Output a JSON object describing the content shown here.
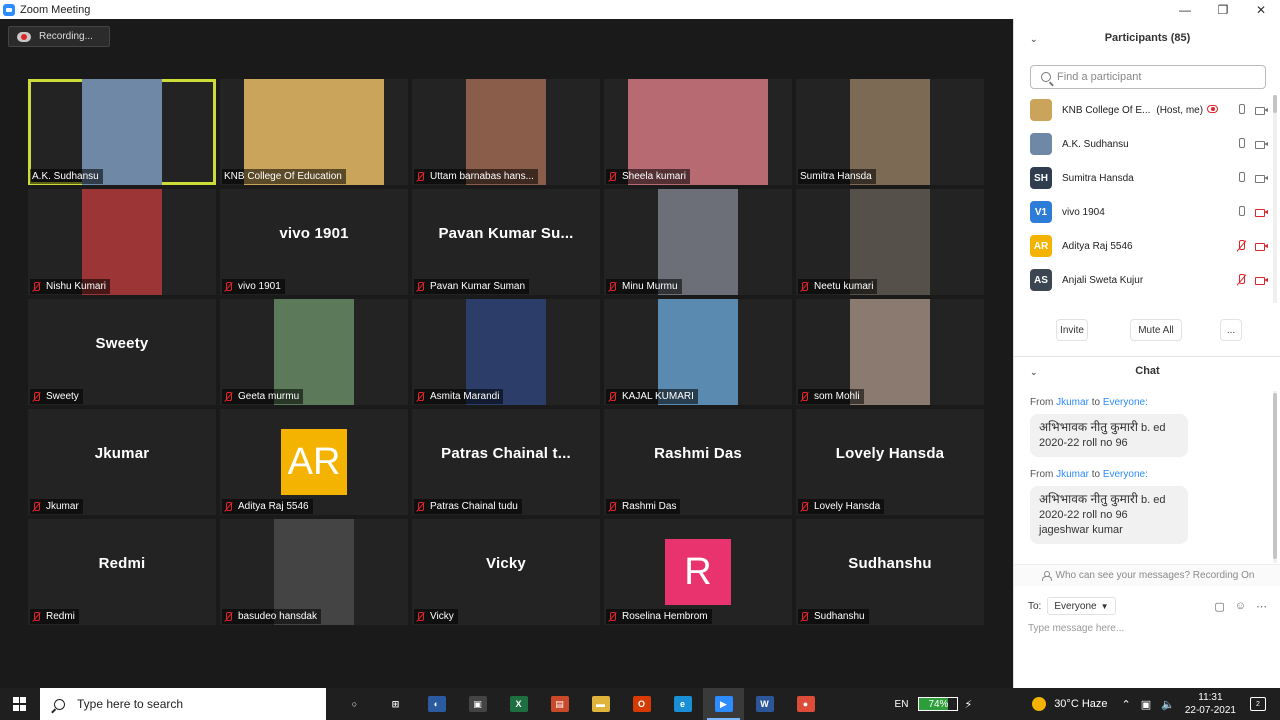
{
  "window": {
    "title": "Zoom Meeting",
    "controls": [
      "—",
      "❐",
      "✕"
    ]
  },
  "recording": {
    "label": "Recording..."
  },
  "tiles": [
    {
      "name": "A.K. Sudhansu",
      "type": "video",
      "muted": false,
      "active": true,
      "bg": "#6e88a6"
    },
    {
      "name": "KNB College Of Education",
      "type": "video",
      "muted": false,
      "bg": "#c9a45a"
    },
    {
      "name": "Uttam barnabas hans...",
      "type": "video",
      "muted": true,
      "bg": "#8a5c4a"
    },
    {
      "name": "Sheela kumari",
      "type": "video",
      "muted": true,
      "bg": "#b86a73"
    },
    {
      "name": "Sumitra Hansda",
      "type": "video",
      "muted": false,
      "bg": "#7d6a55"
    },
    {
      "name": "Nishu Kumari",
      "type": "video",
      "muted": true,
      "bg": "#9c3535"
    },
    {
      "name": "vivo 1901",
      "type": "name",
      "big": "vivo 1901",
      "muted": true
    },
    {
      "name": "Pavan Kumar Suman",
      "type": "name",
      "big": "Pavan Kumar Su...",
      "muted": true
    },
    {
      "name": "Minu Murmu",
      "type": "video",
      "muted": true,
      "bg": "#6c6f78"
    },
    {
      "name": "Neetu kumari",
      "type": "video",
      "muted": true,
      "bg": "#55504a"
    },
    {
      "name": "Sweety",
      "type": "name",
      "big": "Sweety",
      "muted": true
    },
    {
      "name": "Geeta murmu",
      "type": "video",
      "muted": true,
      "bg": "#5c7a5a"
    },
    {
      "name": "Asmita Marandi",
      "type": "video",
      "muted": true,
      "bg": "#2c3d6a"
    },
    {
      "name": "KAJAL KUMARI",
      "type": "video",
      "muted": true,
      "bg": "#5a8ab0"
    },
    {
      "name": "som Mohli",
      "type": "video",
      "muted": true,
      "bg": "#8a7a70"
    },
    {
      "name": "Jkumar",
      "type": "name",
      "big": "Jkumar",
      "muted": true
    },
    {
      "name": "Aditya Raj 5546",
      "type": "avatar",
      "big": "AR",
      "avatar_color": "#f5b301",
      "muted": true
    },
    {
      "name": "Patras Chainal tudu",
      "type": "name",
      "big": "Patras Chainal t...",
      "muted": true
    },
    {
      "name": "Rashmi Das",
      "type": "name",
      "big": "Rashmi Das",
      "muted": true
    },
    {
      "name": "Lovely Hansda",
      "type": "name",
      "big": "Lovely Hansda",
      "muted": true
    },
    {
      "name": "Redmi",
      "type": "name",
      "big": "Redmi",
      "muted": true
    },
    {
      "name": "basudeo hansdak",
      "type": "video",
      "muted": true,
      "bg": "#444444"
    },
    {
      "name": "Vicky",
      "type": "name",
      "big": "Vicky",
      "muted": true
    },
    {
      "name": "Roselina Hembrom",
      "type": "avatar",
      "big": "R",
      "avatar_color": "#e8336f",
      "muted": true
    },
    {
      "name": "Sudhanshu",
      "type": "name",
      "big": "Sudhanshu",
      "muted": true
    }
  ],
  "participants": {
    "title": "Participants (85)",
    "search_placeholder": "Find a participant",
    "list": [
      {
        "name": "KNB College Of E...",
        "role": "(Host, me)",
        "initials": "",
        "avatar_color": "#c9a45a",
        "mic": "on",
        "cam": "on",
        "recording": true
      },
      {
        "name": "A.K. Sudhansu",
        "role": "",
        "initials": "",
        "avatar_color": "#6e88a6",
        "mic": "on",
        "cam": "on"
      },
      {
        "name": "Sumitra Hansda",
        "role": "",
        "initials": "SH",
        "avatar_color": "#2f3d4f",
        "mic": "on",
        "cam": "on"
      },
      {
        "name": "vivo 1904",
        "role": "",
        "initials": "V1",
        "avatar_color": "#2d7cd8",
        "mic": "on",
        "cam": "off"
      },
      {
        "name": "Aditya Raj 5546",
        "role": "",
        "initials": "AR",
        "avatar_color": "#f5b301",
        "mic": "off",
        "cam": "off"
      },
      {
        "name": "Anjali Sweta Kujur",
        "role": "",
        "initials": "AS",
        "avatar_color": "#3c4653",
        "mic": "off",
        "cam": "off"
      }
    ],
    "buttons": {
      "invite": "Invite",
      "mute_all": "Mute All",
      "more": "..."
    }
  },
  "chat": {
    "title": "Chat",
    "messages": [
      {
        "from_prefix": "From",
        "from": "Jkumar",
        "to_word": "to",
        "to": "Everyone:",
        "hindi": "अभिभावक नीतु कुमारी",
        "text": " b. ed 2020-22 roll no 96"
      },
      {
        "from_prefix": "From",
        "from": "Jkumar",
        "to_word": "to",
        "to": "Everyone:",
        "hindi": "अभिभावक नीतु कुमारी",
        "text": " b. ed 2020-22 roll no 96  jageshwar kumar"
      }
    ],
    "note": "Who can see your messages? Recording On",
    "to_label": "To:",
    "to_value": "Everyone",
    "input_placeholder": "Type message here..."
  },
  "taskbar": {
    "search_placeholder": "Type here to search",
    "apps": [
      {
        "name": "cortana",
        "glyph": "○",
        "color": "transparent"
      },
      {
        "name": "task-view",
        "glyph": "⊞",
        "color": "transparent"
      },
      {
        "name": "app-1",
        "glyph": "◐",
        "color": "#2a5aa0"
      },
      {
        "name": "store",
        "glyph": "▣",
        "color": "#444"
      },
      {
        "name": "excel",
        "glyph": "X",
        "color": "#1d6f42"
      },
      {
        "name": "app-2",
        "glyph": "▤",
        "color": "#c94a2a"
      },
      {
        "name": "explorer",
        "glyph": "▬",
        "color": "#e0b33a"
      },
      {
        "name": "office",
        "glyph": "O",
        "color": "#d83b01"
      },
      {
        "name": "edge",
        "glyph": "e",
        "color": "#1a8fd6"
      },
      {
        "name": "zoom",
        "glyph": "▶",
        "color": "#2d8cff",
        "active": true
      },
      {
        "name": "word",
        "glyph": "W",
        "color": "#2b579a"
      },
      {
        "name": "chrome",
        "glyph": "●",
        "color": "#dd4b39"
      }
    ],
    "lang": "EN",
    "battery": "74%",
    "weather": "30°C  Haze",
    "time": "11:31",
    "date": "22-07-2021",
    "notifications": "2"
  }
}
